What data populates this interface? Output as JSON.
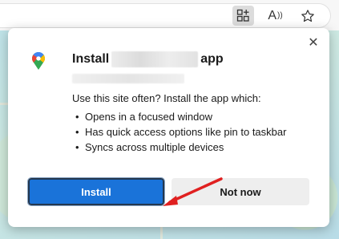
{
  "toolbar": {
    "icons": [
      "app-available-icon",
      "read-aloud-icon",
      "favorite-star-icon"
    ],
    "read_aloud_glyph": "A"
  },
  "dialog": {
    "title_prefix": "Install",
    "title_suffix": "app",
    "description": "Use this site often? Install the app which:",
    "features": [
      "Opens in a focused window",
      "Has quick access options like pin to taskbar",
      "Syncs across multiple devices"
    ],
    "install_label": "Install",
    "not_now_label": "Not now",
    "close_glyph": "✕"
  },
  "colors": {
    "install_button": "#1a73d9",
    "annotation_arrow": "#e02020"
  }
}
